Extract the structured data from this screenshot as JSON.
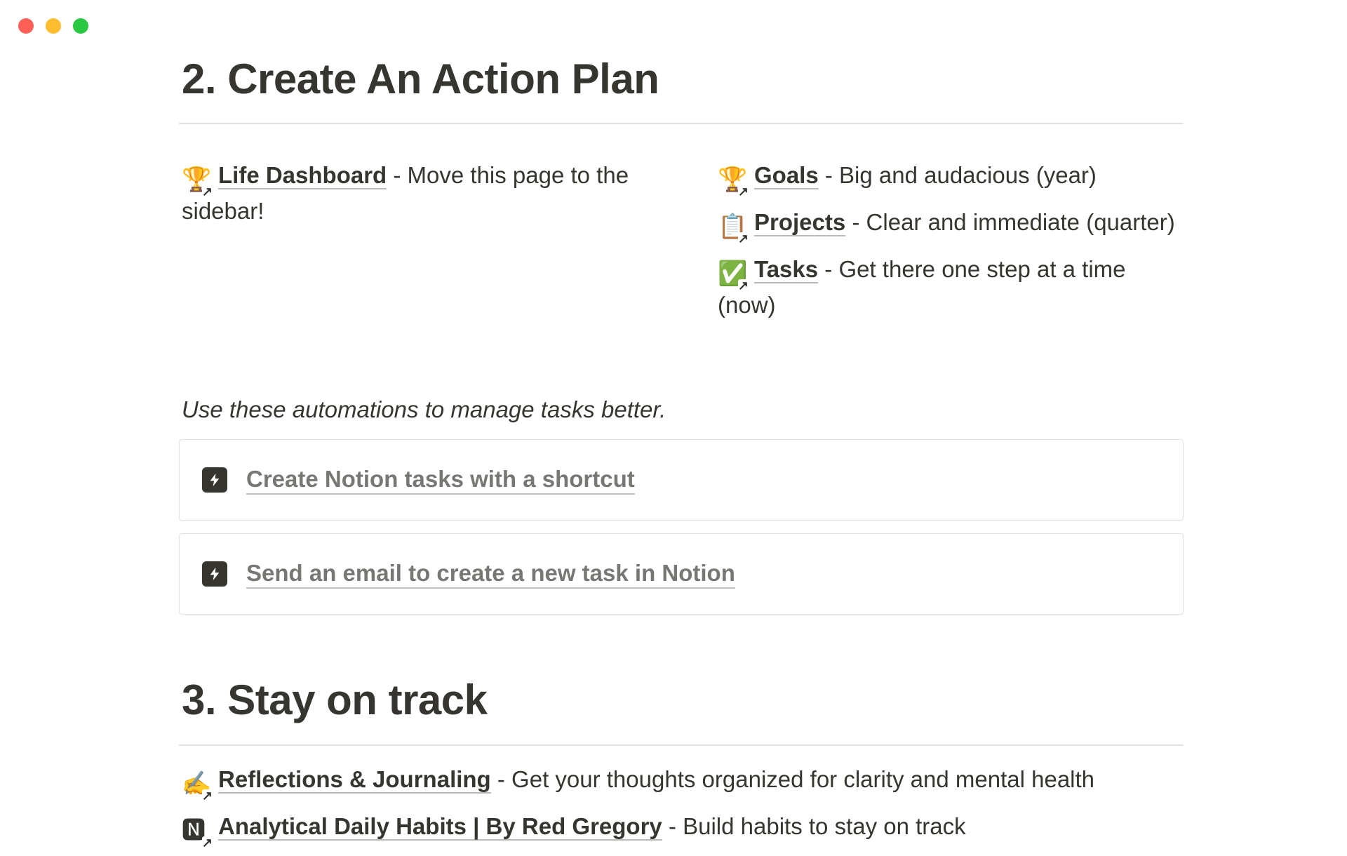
{
  "window": {
    "controls": [
      "close",
      "minimize",
      "zoom"
    ]
  },
  "section_action_plan": {
    "heading": "2. Create An Action Plan",
    "left_links": [
      {
        "icon": "trophy-icon",
        "emoji": "🏆",
        "label": "Life Dashboard",
        "desc": " - Move this page to the sidebar!"
      }
    ],
    "right_links": [
      {
        "icon": "trophy-icon",
        "emoji": "🏆",
        "label": "Goals",
        "desc": " - Big and audacious (year)"
      },
      {
        "icon": "clipboard-icon",
        "emoji": "📋",
        "label": "Projects",
        "desc": " - Clear and immediate (quarter)"
      },
      {
        "icon": "check-mark-icon",
        "emoji": "✅",
        "label": "Tasks",
        "desc": " - Get there one step at a time (now)"
      }
    ],
    "note": "Use these automations to manage tasks better.",
    "buttons": [
      {
        "icon": "lightning-icon",
        "label": "Create Notion tasks with a shortcut"
      },
      {
        "icon": "lightning-icon",
        "label": "Send an email to create a new task in Notion"
      }
    ]
  },
  "section_stay_on_track": {
    "heading": "3. Stay on track",
    "links": [
      {
        "icon": "writing-hand-icon",
        "emoji": "✍️",
        "label": "Reflections & Journaling",
        "desc": " - Get your thoughts organized for clarity and mental health"
      },
      {
        "icon": "notion-logo-icon",
        "emoji": "🅽",
        "label": "Analytical Daily Habits | By Red Gregory",
        "desc": " - Build habits to stay on track"
      }
    ]
  },
  "colors": {
    "text": "#37352f",
    "muted": "#787774",
    "divider": "#e3e2e0"
  }
}
